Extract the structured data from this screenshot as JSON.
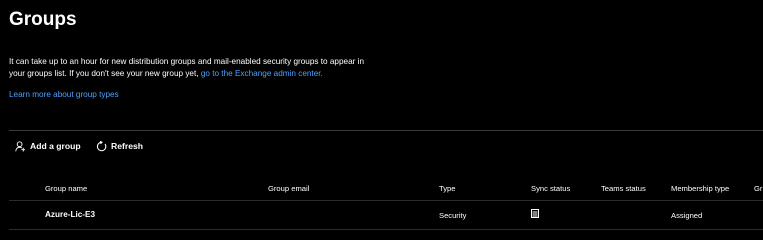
{
  "header": {
    "title": "Groups"
  },
  "info": {
    "line1": "It can take up to an hour for new distribution groups and mail-enabled security groups to appear in",
    "line2_prefix": "your groups list. If you don't see your new group yet, ",
    "line2_link": "go to the Exchange admin center.",
    "learn_more": "Learn more about group types"
  },
  "toolbar": {
    "add_label": "Add a group",
    "refresh_label": "Refresh"
  },
  "table": {
    "columns": {
      "name": "Group name",
      "email": "Group email",
      "type": "Type",
      "sync": "Sync status",
      "teams": "Teams status",
      "membership": "Membership type",
      "extra": "Gr"
    },
    "rows": [
      {
        "name_bold": "Azure",
        "name_rest": "-Lic-E3",
        "email": "",
        "type": "Security",
        "sync_icon": "cloud-sync-icon",
        "teams": "",
        "membership": "Assigned"
      }
    ]
  },
  "colors": {
    "background": "#000000",
    "text": "#ffffff",
    "link": "#4ea1ff",
    "divider": "#3a3a3a"
  }
}
